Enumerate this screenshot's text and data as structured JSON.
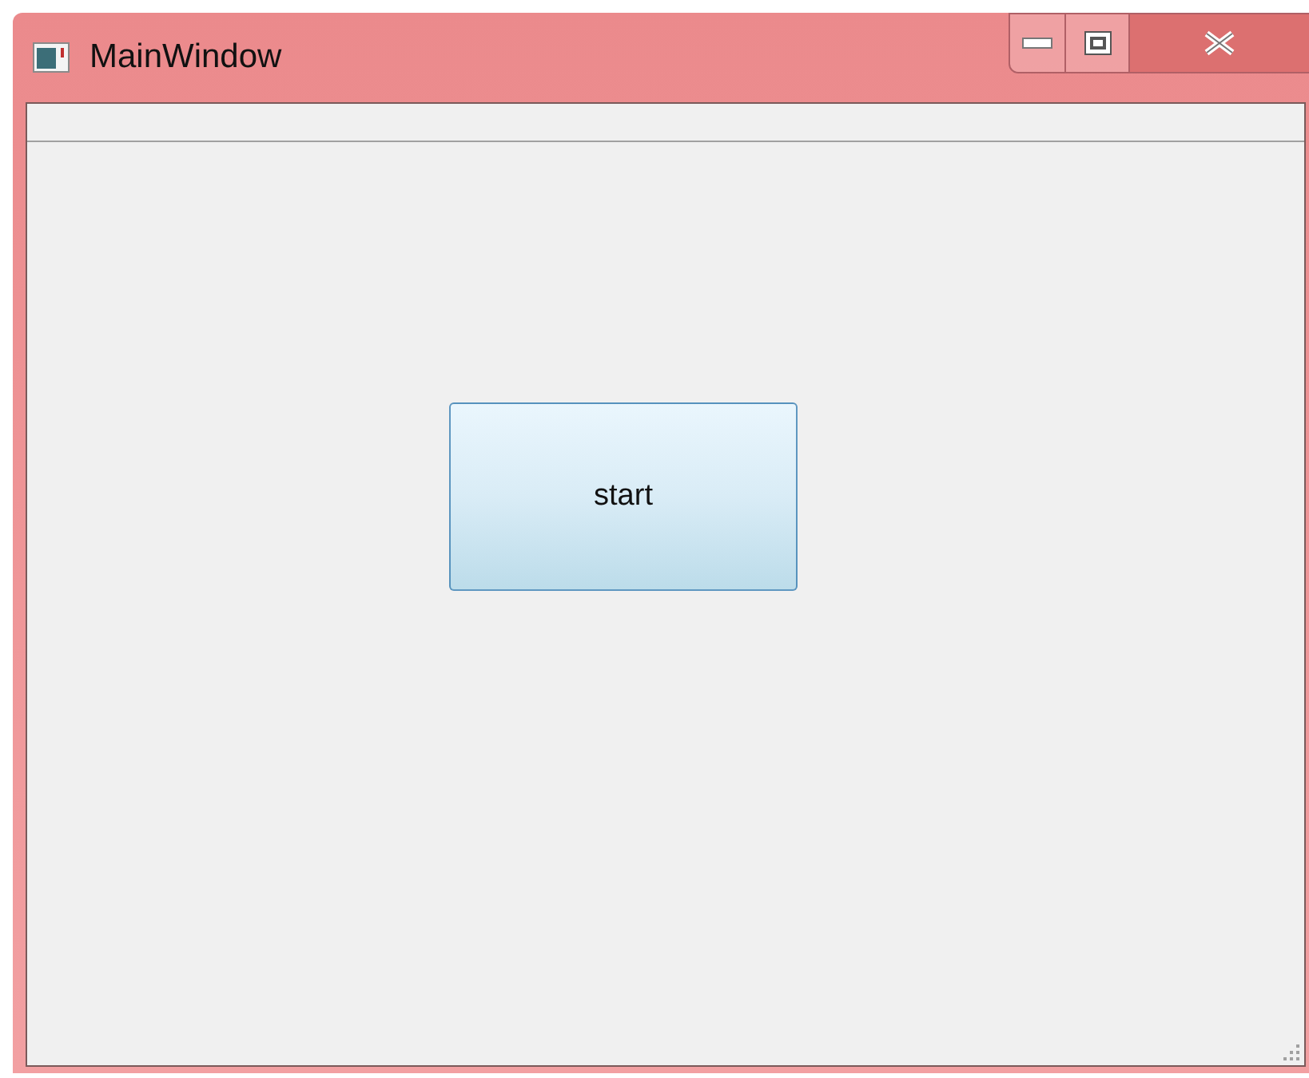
{
  "window": {
    "title": "MainWindow"
  },
  "button": {
    "label": "start"
  }
}
